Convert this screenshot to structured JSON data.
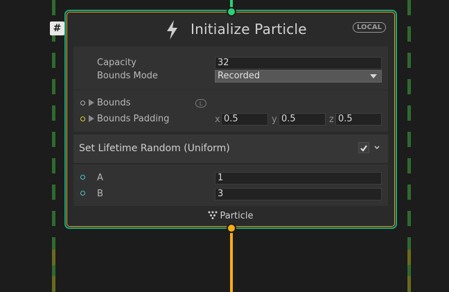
{
  "colors": {
    "flow_green": "#29d276",
    "flow_orange": "#f6ac14",
    "node_border": "#1aa57b",
    "block_border": "#e8a318",
    "port_yellow": "#d7cf34",
    "port_cyan": "#4fc3c3"
  },
  "node": {
    "badge": "#",
    "icon": "bolt-icon",
    "title": "Initialize Particle",
    "space_badge": "LOCAL",
    "footer_label": "Particle",
    "footer_icon": "particle-icon"
  },
  "settings": {
    "capacity_label": "Capacity",
    "capacity_value": "32",
    "bounds_mode_label": "Bounds Mode",
    "bounds_mode_value": "Recorded"
  },
  "properties": {
    "bounds_label": "Bounds",
    "bounds_space_badge": "L",
    "bounds_padding_label": "Bounds Padding",
    "padding_x_label": "x",
    "padding_x": "0.5",
    "padding_y_label": "y",
    "padding_y": "0.5",
    "padding_z_label": "z",
    "padding_z": "0.5"
  },
  "block": {
    "title": "Set Lifetime Random (Uniform)",
    "enabled": true,
    "a_label": "A",
    "a_value": "1",
    "b_label": "B",
    "b_value": "3"
  }
}
